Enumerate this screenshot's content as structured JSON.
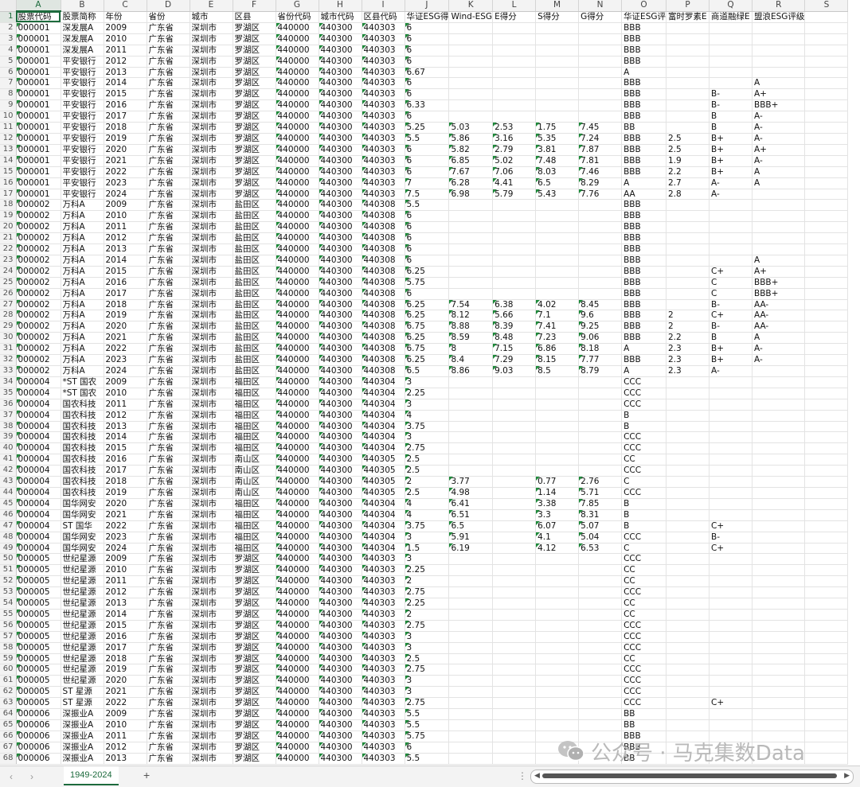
{
  "columns": [
    "A",
    "B",
    "C",
    "D",
    "E",
    "F",
    "G",
    "H",
    "I",
    "J",
    "K",
    "L",
    "M",
    "N",
    "O",
    "P",
    "Q",
    "R",
    "S"
  ],
  "headers": [
    "股票代码",
    "股票简称",
    "年份",
    "省份",
    "城市",
    "区县",
    "省份代码",
    "城市代码",
    "区县代码",
    "华证ESG得",
    "Wind-ESG",
    "E得分",
    "S得分",
    "G得分",
    "华证ESG评",
    "富时罗素E",
    "商道融绿E",
    "盟浪ESG评级",
    ""
  ],
  "rows": [
    [
      "000001",
      "深发展A",
      "2009",
      "广东省",
      "深圳市",
      "罗湖区",
      "440000",
      "440300",
      "440303",
      "6",
      "",
      "",
      "",
      "",
      "BBB",
      "",
      "",
      ""
    ],
    [
      "000001",
      "深发展A",
      "2010",
      "广东省",
      "深圳市",
      "罗湖区",
      "440000",
      "440300",
      "440303",
      "6",
      "",
      "",
      "",
      "",
      "BBB",
      "",
      "",
      ""
    ],
    [
      "000001",
      "深发展A",
      "2011",
      "广东省",
      "深圳市",
      "罗湖区",
      "440000",
      "440300",
      "440303",
      "6",
      "",
      "",
      "",
      "",
      "BBB",
      "",
      "",
      ""
    ],
    [
      "000001",
      "平安银行",
      "2012",
      "广东省",
      "深圳市",
      "罗湖区",
      "440000",
      "440300",
      "440303",
      "6",
      "",
      "",
      "",
      "",
      "BBB",
      "",
      "",
      ""
    ],
    [
      "000001",
      "平安银行",
      "2013",
      "广东省",
      "深圳市",
      "罗湖区",
      "440000",
      "440300",
      "440303",
      "6.67",
      "",
      "",
      "",
      "",
      "A",
      "",
      "",
      ""
    ],
    [
      "000001",
      "平安银行",
      "2014",
      "广东省",
      "深圳市",
      "罗湖区",
      "440000",
      "440300",
      "440303",
      "6",
      "",
      "",
      "",
      "",
      "BBB",
      "",
      "",
      "A"
    ],
    [
      "000001",
      "平安银行",
      "2015",
      "广东省",
      "深圳市",
      "罗湖区",
      "440000",
      "440300",
      "440303",
      "6",
      "",
      "",
      "",
      "",
      "BBB",
      "",
      "B-",
      "A+"
    ],
    [
      "000001",
      "平安银行",
      "2016",
      "广东省",
      "深圳市",
      "罗湖区",
      "440000",
      "440300",
      "440303",
      "6.33",
      "",
      "",
      "",
      "",
      "BBB",
      "",
      "B-",
      "BBB+"
    ],
    [
      "000001",
      "平安银行",
      "2017",
      "广东省",
      "深圳市",
      "罗湖区",
      "440000",
      "440300",
      "440303",
      "6",
      "",
      "",
      "",
      "",
      "BBB",
      "",
      "B",
      "A-"
    ],
    [
      "000001",
      "平安银行",
      "2018",
      "广东省",
      "深圳市",
      "罗湖区",
      "440000",
      "440300",
      "440303",
      "5.25",
      "5.03",
      "2.53",
      "1.75",
      "7.45",
      "BB",
      "",
      "B",
      "A-"
    ],
    [
      "000001",
      "平安银行",
      "2019",
      "广东省",
      "深圳市",
      "罗湖区",
      "440000",
      "440300",
      "440303",
      "5.5",
      "5.86",
      "3.16",
      "5.35",
      "7.24",
      "BBB",
      "2.5",
      "B+",
      "A-"
    ],
    [
      "000001",
      "平安银行",
      "2020",
      "广东省",
      "深圳市",
      "罗湖区",
      "440000",
      "440300",
      "440303",
      "6",
      "5.82",
      "2.79",
      "3.81",
      "7.87",
      "BBB",
      "2.5",
      "B+",
      "A+"
    ],
    [
      "000001",
      "平安银行",
      "2021",
      "广东省",
      "深圳市",
      "罗湖区",
      "440000",
      "440300",
      "440303",
      "6",
      "6.85",
      "5.02",
      "7.48",
      "7.81",
      "BBB",
      "1.9",
      "B+",
      "A-"
    ],
    [
      "000001",
      "平安银行",
      "2022",
      "广东省",
      "深圳市",
      "罗湖区",
      "440000",
      "440300",
      "440303",
      "6",
      "7.67",
      "7.06",
      "8.03",
      "7.46",
      "BBB",
      "2.2",
      "B+",
      "A"
    ],
    [
      "000001",
      "平安银行",
      "2023",
      "广东省",
      "深圳市",
      "罗湖区",
      "440000",
      "440300",
      "440303",
      "7",
      "6.28",
      "4.41",
      "6.5",
      "8.29",
      "A",
      "2.7",
      "A-",
      "A"
    ],
    [
      "000001",
      "平安银行",
      "2024",
      "广东省",
      "深圳市",
      "罗湖区",
      "440000",
      "440300",
      "440303",
      "7.5",
      "6.98",
      "5.79",
      "5.43",
      "7.76",
      "AA",
      "2.8",
      "A-",
      ""
    ],
    [
      "000002",
      "万科A",
      "2009",
      "广东省",
      "深圳市",
      "盐田区",
      "440000",
      "440300",
      "440308",
      "5.5",
      "",
      "",
      "",
      "",
      "BBB",
      "",
      "",
      ""
    ],
    [
      "000002",
      "万科A",
      "2010",
      "广东省",
      "深圳市",
      "盐田区",
      "440000",
      "440300",
      "440308",
      "6",
      "",
      "",
      "",
      "",
      "BBB",
      "",
      "",
      ""
    ],
    [
      "000002",
      "万科A",
      "2011",
      "广东省",
      "深圳市",
      "盐田区",
      "440000",
      "440300",
      "440308",
      "6",
      "",
      "",
      "",
      "",
      "BBB",
      "",
      "",
      ""
    ],
    [
      "000002",
      "万科A",
      "2012",
      "广东省",
      "深圳市",
      "盐田区",
      "440000",
      "440300",
      "440308",
      "6",
      "",
      "",
      "",
      "",
      "BBB",
      "",
      "",
      ""
    ],
    [
      "000002",
      "万科A",
      "2013",
      "广东省",
      "深圳市",
      "盐田区",
      "440000",
      "440300",
      "440308",
      "6",
      "",
      "",
      "",
      "",
      "BBB",
      "",
      "",
      ""
    ],
    [
      "000002",
      "万科A",
      "2014",
      "广东省",
      "深圳市",
      "盐田区",
      "440000",
      "440300",
      "440308",
      "6",
      "",
      "",
      "",
      "",
      "BBB",
      "",
      "",
      "A"
    ],
    [
      "000002",
      "万科A",
      "2015",
      "广东省",
      "深圳市",
      "盐田区",
      "440000",
      "440300",
      "440308",
      "6.25",
      "",
      "",
      "",
      "",
      "BBB",
      "",
      "C+",
      "A+"
    ],
    [
      "000002",
      "万科A",
      "2016",
      "广东省",
      "深圳市",
      "盐田区",
      "440000",
      "440300",
      "440308",
      "5.75",
      "",
      "",
      "",
      "",
      "BBB",
      "",
      "C",
      "BBB+"
    ],
    [
      "000002",
      "万科A",
      "2017",
      "广东省",
      "深圳市",
      "盐田区",
      "440000",
      "440300",
      "440308",
      "6",
      "",
      "",
      "",
      "",
      "BBB",
      "",
      "C",
      "BBB+"
    ],
    [
      "000002",
      "万科A",
      "2018",
      "广东省",
      "深圳市",
      "盐田区",
      "440000",
      "440300",
      "440308",
      "6.25",
      "7.54",
      "6.38",
      "4.02",
      "8.45",
      "BBB",
      "",
      "B-",
      "AA-"
    ],
    [
      "000002",
      "万科A",
      "2019",
      "广东省",
      "深圳市",
      "盐田区",
      "440000",
      "440300",
      "440308",
      "6.25",
      "8.12",
      "5.66",
      "7.1",
      "9.6",
      "BBB",
      "2",
      "C+",
      "AA-"
    ],
    [
      "000002",
      "万科A",
      "2020",
      "广东省",
      "深圳市",
      "盐田区",
      "440000",
      "440300",
      "440308",
      "6.75",
      "8.88",
      "8.39",
      "7.41",
      "9.25",
      "BBB",
      "2",
      "B-",
      "AA-"
    ],
    [
      "000002",
      "万科A",
      "2021",
      "广东省",
      "深圳市",
      "盐田区",
      "440000",
      "440300",
      "440308",
      "6.25",
      "8.59",
      "8.48",
      "7.23",
      "9.06",
      "BBB",
      "2.2",
      "B",
      "A"
    ],
    [
      "000002",
      "万科A",
      "2022",
      "广东省",
      "深圳市",
      "盐田区",
      "440000",
      "440300",
      "440308",
      "6.75",
      "8",
      "7.15",
      "6.86",
      "8.18",
      "A",
      "2.3",
      "B+",
      "A-"
    ],
    [
      "000002",
      "万科A",
      "2023",
      "广东省",
      "深圳市",
      "盐田区",
      "440000",
      "440300",
      "440308",
      "6.25",
      "8.4",
      "7.29",
      "8.15",
      "7.77",
      "BBB",
      "2.3",
      "B+",
      "A-"
    ],
    [
      "000002",
      "万科A",
      "2024",
      "广东省",
      "深圳市",
      "盐田区",
      "440000",
      "440300",
      "440308",
      "6.5",
      "8.86",
      "9.03",
      "8.5",
      "8.79",
      "A",
      "2.3",
      "A-",
      ""
    ],
    [
      "000004",
      "*ST 国农",
      "2009",
      "广东省",
      "深圳市",
      "福田区",
      "440000",
      "440300",
      "440304",
      "3",
      "",
      "",
      "",
      "",
      "CCC",
      "",
      "",
      ""
    ],
    [
      "000004",
      "*ST 国农",
      "2010",
      "广东省",
      "深圳市",
      "福田区",
      "440000",
      "440300",
      "440304",
      "2.25",
      "",
      "",
      "",
      "",
      "CCC",
      "",
      "",
      ""
    ],
    [
      "000004",
      "国农科技",
      "2011",
      "广东省",
      "深圳市",
      "福田区",
      "440000",
      "440300",
      "440304",
      "3",
      "",
      "",
      "",
      "",
      "CCC",
      "",
      "",
      ""
    ],
    [
      "000004",
      "国农科技",
      "2012",
      "广东省",
      "深圳市",
      "福田区",
      "440000",
      "440300",
      "440304",
      "4",
      "",
      "",
      "",
      "",
      "B",
      "",
      "",
      ""
    ],
    [
      "000004",
      "国农科技",
      "2013",
      "广东省",
      "深圳市",
      "福田区",
      "440000",
      "440300",
      "440304",
      "3.75",
      "",
      "",
      "",
      "",
      "B",
      "",
      "",
      ""
    ],
    [
      "000004",
      "国农科技",
      "2014",
      "广东省",
      "深圳市",
      "福田区",
      "440000",
      "440300",
      "440304",
      "3",
      "",
      "",
      "",
      "",
      "CCC",
      "",
      "",
      ""
    ],
    [
      "000004",
      "国农科技",
      "2015",
      "广东省",
      "深圳市",
      "福田区",
      "440000",
      "440300",
      "440304",
      "2.75",
      "",
      "",
      "",
      "",
      "CCC",
      "",
      "",
      ""
    ],
    [
      "000004",
      "国农科技",
      "2016",
      "广东省",
      "深圳市",
      "南山区",
      "440000",
      "440300",
      "440305",
      "2.5",
      "",
      "",
      "",
      "",
      "CC",
      "",
      "",
      ""
    ],
    [
      "000004",
      "国农科技",
      "2017",
      "广东省",
      "深圳市",
      "南山区",
      "440000",
      "440300",
      "440305",
      "2.5",
      "",
      "",
      "",
      "",
      "CCC",
      "",
      "",
      ""
    ],
    [
      "000004",
      "国农科技",
      "2018",
      "广东省",
      "深圳市",
      "南山区",
      "440000",
      "440300",
      "440305",
      "2",
      "3.77",
      "",
      "0.77",
      "2.76",
      "C",
      "",
      "",
      ""
    ],
    [
      "000004",
      "国农科技",
      "2019",
      "广东省",
      "深圳市",
      "南山区",
      "440000",
      "440300",
      "440305",
      "2.5",
      "4.98",
      "",
      "1.14",
      "5.71",
      "CCC",
      "",
      "",
      ""
    ],
    [
      "000004",
      "国华网安",
      "2020",
      "广东省",
      "深圳市",
      "福田区",
      "440000",
      "440300",
      "440304",
      "4",
      "6.41",
      "",
      "3.38",
      "7.85",
      "B",
      "",
      "",
      ""
    ],
    [
      "000004",
      "国华网安",
      "2021",
      "广东省",
      "深圳市",
      "福田区",
      "440000",
      "440300",
      "440304",
      "4",
      "6.51",
      "",
      "3.3",
      "8.31",
      "B",
      "",
      "",
      ""
    ],
    [
      "000004",
      "ST 国华",
      "2022",
      "广东省",
      "深圳市",
      "福田区",
      "440000",
      "440300",
      "440304",
      "3.75",
      "6.5",
      "",
      "6.07",
      "5.07",
      "B",
      "",
      "C+",
      ""
    ],
    [
      "000004",
      "国华网安",
      "2023",
      "广东省",
      "深圳市",
      "福田区",
      "440000",
      "440300",
      "440304",
      "3",
      "5.91",
      "",
      "4.1",
      "5.04",
      "CCC",
      "",
      "B-",
      ""
    ],
    [
      "000004",
      "国华网安",
      "2024",
      "广东省",
      "深圳市",
      "福田区",
      "440000",
      "440300",
      "440304",
      "1.5",
      "6.19",
      "",
      "4.12",
      "6.53",
      "C",
      "",
      "C+",
      ""
    ],
    [
      "000005",
      "世纪星源",
      "2009",
      "广东省",
      "深圳市",
      "罗湖区",
      "440000",
      "440300",
      "440303",
      "3",
      "",
      "",
      "",
      "",
      "CCC",
      "",
      "",
      ""
    ],
    [
      "000005",
      "世纪星源",
      "2010",
      "广东省",
      "深圳市",
      "罗湖区",
      "440000",
      "440300",
      "440303",
      "2.25",
      "",
      "",
      "",
      "",
      "CC",
      "",
      "",
      ""
    ],
    [
      "000005",
      "世纪星源",
      "2011",
      "广东省",
      "深圳市",
      "罗湖区",
      "440000",
      "440300",
      "440303",
      "2",
      "",
      "",
      "",
      "",
      "CC",
      "",
      "",
      ""
    ],
    [
      "000005",
      "世纪星源",
      "2012",
      "广东省",
      "深圳市",
      "罗湖区",
      "440000",
      "440300",
      "440303",
      "2.75",
      "",
      "",
      "",
      "",
      "CCC",
      "",
      "",
      ""
    ],
    [
      "000005",
      "世纪星源",
      "2013",
      "广东省",
      "深圳市",
      "罗湖区",
      "440000",
      "440300",
      "440303",
      "2.25",
      "",
      "",
      "",
      "",
      "CC",
      "",
      "",
      ""
    ],
    [
      "000005",
      "世纪星源",
      "2014",
      "广东省",
      "深圳市",
      "罗湖区",
      "440000",
      "440300",
      "440303",
      "2",
      "",
      "",
      "",
      "",
      "CC",
      "",
      "",
      ""
    ],
    [
      "000005",
      "世纪星源",
      "2015",
      "广东省",
      "深圳市",
      "罗湖区",
      "440000",
      "440300",
      "440303",
      "2.75",
      "",
      "",
      "",
      "",
      "CCC",
      "",
      "",
      ""
    ],
    [
      "000005",
      "世纪星源",
      "2016",
      "广东省",
      "深圳市",
      "罗湖区",
      "440000",
      "440300",
      "440303",
      "3",
      "",
      "",
      "",
      "",
      "CCC",
      "",
      "",
      ""
    ],
    [
      "000005",
      "世纪星源",
      "2017",
      "广东省",
      "深圳市",
      "罗湖区",
      "440000",
      "440300",
      "440303",
      "3",
      "",
      "",
      "",
      "",
      "CCC",
      "",
      "",
      ""
    ],
    [
      "000005",
      "世纪星源",
      "2018",
      "广东省",
      "深圳市",
      "罗湖区",
      "440000",
      "440300",
      "440303",
      "2.5",
      "",
      "",
      "",
      "",
      "CC",
      "",
      "",
      ""
    ],
    [
      "000005",
      "世纪星源",
      "2019",
      "广东省",
      "深圳市",
      "罗湖区",
      "440000",
      "440300",
      "440303",
      "2.75",
      "",
      "",
      "",
      "",
      "CCC",
      "",
      "",
      ""
    ],
    [
      "000005",
      "世纪星源",
      "2020",
      "广东省",
      "深圳市",
      "罗湖区",
      "440000",
      "440300",
      "440303",
      "3",
      "",
      "",
      "",
      "",
      "CCC",
      "",
      "",
      ""
    ],
    [
      "000005",
      "ST 星源",
      "2021",
      "广东省",
      "深圳市",
      "罗湖区",
      "440000",
      "440300",
      "440303",
      "3",
      "",
      "",
      "",
      "",
      "CCC",
      "",
      "",
      ""
    ],
    [
      "000005",
      "ST 星源",
      "2022",
      "广东省",
      "深圳市",
      "罗湖区",
      "440000",
      "440300",
      "440303",
      "2.75",
      "",
      "",
      "",
      "",
      "CCC",
      "",
      "C+",
      ""
    ],
    [
      "000006",
      "深振业A",
      "2009",
      "广东省",
      "深圳市",
      "罗湖区",
      "440000",
      "440300",
      "440303",
      "5.5",
      "",
      "",
      "",
      "",
      "BB",
      "",
      "",
      ""
    ],
    [
      "000006",
      "深振业A",
      "2010",
      "广东省",
      "深圳市",
      "罗湖区",
      "440000",
      "440300",
      "440303",
      "5.5",
      "",
      "",
      "",
      "",
      "BB",
      "",
      "",
      ""
    ],
    [
      "000006",
      "深振业A",
      "2011",
      "广东省",
      "深圳市",
      "罗湖区",
      "440000",
      "440300",
      "440303",
      "5.75",
      "",
      "",
      "",
      "",
      "BBB",
      "",
      "",
      ""
    ],
    [
      "000006",
      "深振业A",
      "2012",
      "广东省",
      "深圳市",
      "罗湖区",
      "440000",
      "440300",
      "440303",
      "6",
      "",
      "",
      "",
      "",
      "BBB",
      "",
      "",
      ""
    ],
    [
      "000006",
      "深振业A",
      "2013",
      "广东省",
      "深圳市",
      "罗湖区",
      "440000",
      "440300",
      "440303",
      "5.5",
      "",
      "",
      "",
      "",
      "BB",
      "",
      "",
      ""
    ]
  ],
  "sheet_tab": "1949-2024",
  "add_sheet_label": "+",
  "nav": {
    "prev": "‹",
    "next": "›",
    "dots": "⋮"
  },
  "watermark": {
    "text": "公众号 · 马克集数Data",
    "icon": "wechat-icon"
  },
  "colors": {
    "accent": "#1d6b3d",
    "indicator": "#1e8a3a"
  }
}
